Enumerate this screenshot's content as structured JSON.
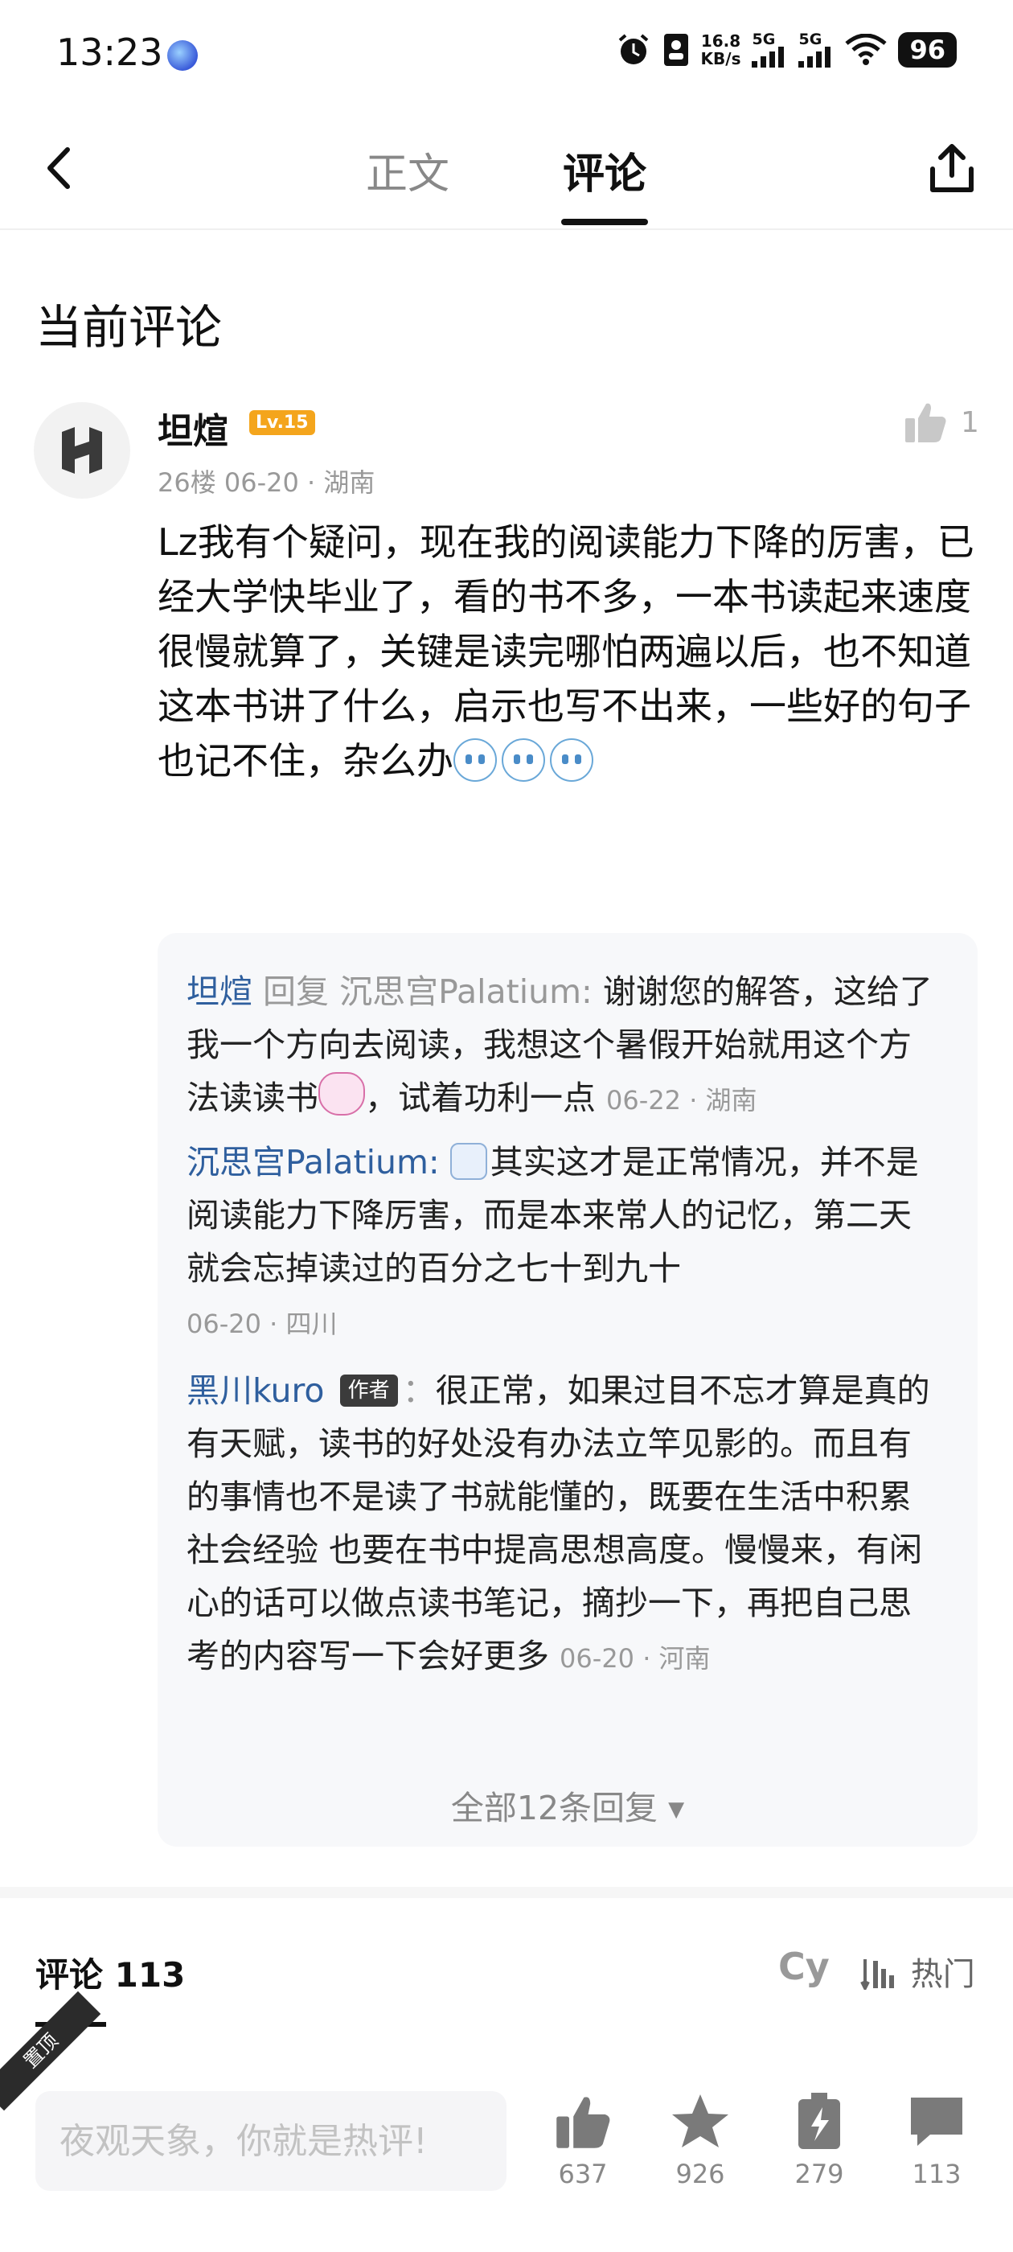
{
  "status_bar": {
    "time": "13:23",
    "speed_top": "16.8",
    "speed_bottom": "KB/s",
    "net1": "5G",
    "net2": "5G",
    "battery": "96"
  },
  "nav": {
    "tab_body": "正文",
    "tab_comment": "评论"
  },
  "section_title": "当前评论",
  "comment": {
    "user": "坦煊",
    "level": "Lv.15",
    "meta": "26楼 06-20 · 湖南",
    "likes": "1",
    "body": "Lz我有个疑问，现在我的阅读能力下降的厉害，已经大学快毕业了，看的书不多，一本书读起来速度很慢就算了，关键是读完哪怕两遍以后，也不知道这本书讲了什么，启示也写不出来，一些好的句子也记不住，杂么办"
  },
  "replies": [
    {
      "user": "坦煊",
      "reply_word": "回复",
      "reply_to": "沉思宫Palatium:",
      "text_before": "谢谢您的解答，这给了我一个方向去阅读，我想这个暑假开始就用这个方法读读书",
      "text_after": "，试着功利一点",
      "time": "06-22 · 湖南"
    },
    {
      "user": "沉思宫Palatium:",
      "text": "其实这才是正常情况，并不是阅读能力下降厉害，而是本来常人的记忆，第二天就会忘掉读过的百分之七十到九十",
      "time": "06-20 · 四川"
    },
    {
      "user": "黑川kuro",
      "tag": "作者",
      "colon": "：",
      "text": "很正常，如果过目不忘才算是真的有天赋，读书的好处没有办法立竿见影的。而且有的事情也不是读了书就能懂的，既要在生活中积累社会经验 也要在书中提高思想高度。慢慢来，有闲心的话可以做点读书笔记，摘抄一下，再把自己思考的内容写一下会好更多",
      "time": "06-20 · 河南"
    }
  ],
  "all_replies": "全部12条回复",
  "comments_header": {
    "title": "评论 113",
    "cy": "Cy",
    "sort": "热门"
  },
  "pin_label": "置顶",
  "bottom": {
    "input_placeholder": "夜观天象，你就是热评!",
    "like_count": "637",
    "star_count": "926",
    "charge_count": "279",
    "comment_count": "113"
  }
}
